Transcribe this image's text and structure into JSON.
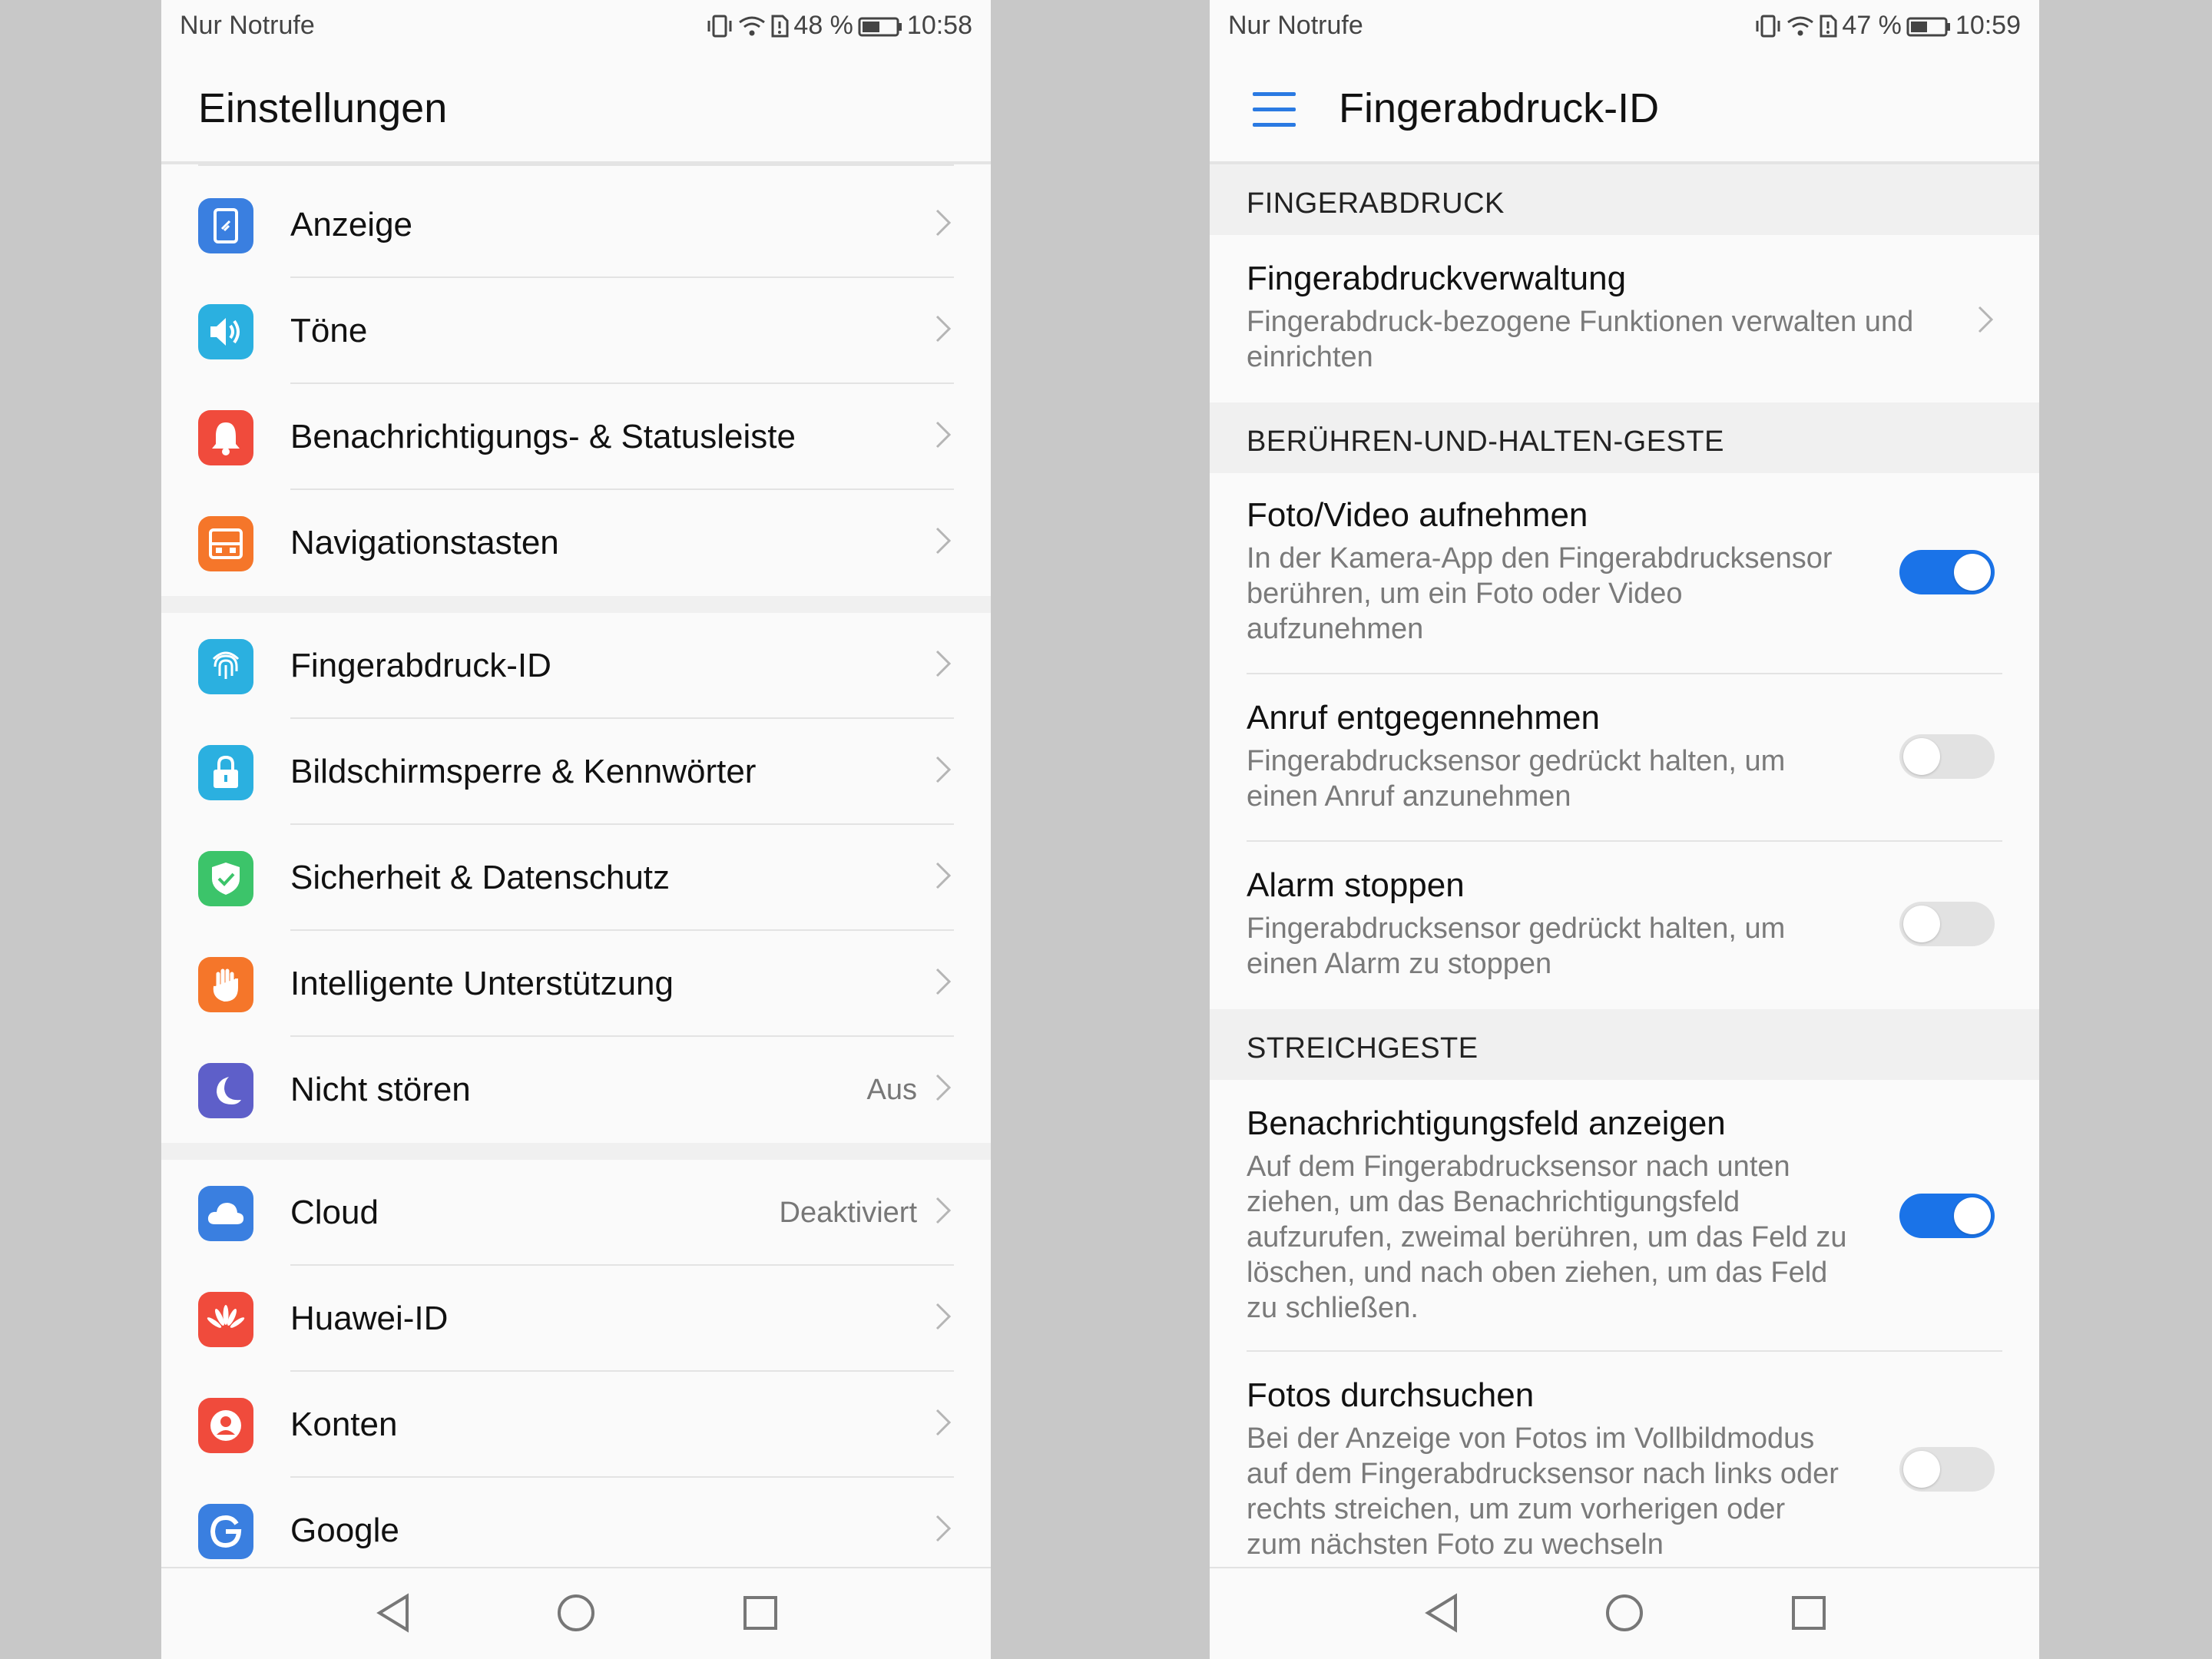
{
  "left": {
    "status": {
      "carrier": "Nur Notrufe",
      "battery": "48 %",
      "time": "10:58"
    },
    "title": "Einstellungen",
    "groups": [
      [
        {
          "label": "Anzeige",
          "icon": "display-icon",
          "color": "#3a7fe0"
        },
        {
          "label": "Töne",
          "icon": "speaker-icon",
          "color": "#2bb0e0"
        },
        {
          "label": "Benachrichtigungs- & Statusleiste",
          "icon": "bell-icon",
          "color": "#f04b3c"
        },
        {
          "label": "Navigationstasten",
          "icon": "navigation-keys-icon",
          "color": "#f5762a"
        }
      ],
      [
        {
          "label": "Fingerabdruck-ID",
          "icon": "fingerprint-icon",
          "color": "#2bb0e0"
        },
        {
          "label": "Bildschirmsperre & Kennwörter",
          "icon": "lock-icon",
          "color": "#2bb0e0"
        },
        {
          "label": "Sicherheit & Datenschutz",
          "icon": "shield-icon",
          "color": "#3cc46a"
        },
        {
          "label": "Intelligente Unterstützung",
          "icon": "hand-icon",
          "color": "#f5762a"
        },
        {
          "label": "Nicht stören",
          "icon": "moon-icon",
          "color": "#5e5fc9",
          "value": "Aus"
        }
      ],
      [
        {
          "label": "Cloud",
          "icon": "cloud-icon",
          "color": "#3a7fe0",
          "value": "Deaktiviert"
        },
        {
          "label": "Huawei-ID",
          "icon": "huawei-icon",
          "color": "#f04b3c"
        },
        {
          "label": "Konten",
          "icon": "account-icon",
          "color": "#f04b3c"
        },
        {
          "label": "Google",
          "icon": "google-icon",
          "color": "#3a7fe0"
        }
      ]
    ]
  },
  "right": {
    "status": {
      "carrier": "Nur Notrufe",
      "battery": "47 %",
      "time": "10:59"
    },
    "title": "Fingerabdruck-ID",
    "sections": [
      {
        "header": "FINGERABDRUCK"
      },
      {
        "header": "BERÜHREN-UND-HALTEN-GESTE"
      },
      {
        "header": "STREICHGESTE"
      }
    ],
    "items": {
      "verwaltung": {
        "title": "Fingerabdruckverwaltung",
        "desc1": "Fingerabdruck-bezogene Funktionen verwalten und",
        "desc2": "einrichten"
      },
      "foto": {
        "title": "Foto/Video aufnehmen",
        "desc1": "In der Kamera-App den Fingerabdrucksensor",
        "desc2": "berühren, um ein Foto oder Video",
        "desc3": "aufzunehmen",
        "on": true
      },
      "anruf": {
        "title": "Anruf entgegennehmen",
        "desc1": "Fingerabdrucksensor gedrückt halten, um",
        "desc2": "einen Anruf anzunehmen",
        "on": false
      },
      "alarm": {
        "title": "Alarm stoppen",
        "desc1": "Fingerabdrucksensor gedrückt halten, um",
        "desc2": "einen Alarm zu stoppen",
        "on": false
      },
      "benach": {
        "title": "Benachrichtigungsfeld anzeigen",
        "desc1": "Auf dem Fingerabdrucksensor nach unten",
        "desc2": "ziehen, um das Benachrichtigungsfeld",
        "desc3": "aufzurufen, zweimal berühren, um das Feld zu",
        "desc4": "löschen, und nach oben ziehen, um das Feld",
        "desc5": "zu schließen.",
        "on": true
      },
      "fotos": {
        "title": "Fotos durchsuchen",
        "desc1": "Bei der Anzeige von Fotos im Vollbildmodus",
        "desc2": "auf dem Fingerabdrucksensor nach links oder",
        "desc3": "rechts streichen, um zum vorherigen oder",
        "desc4": "zum nächsten Foto zu wechseln",
        "on": false
      }
    }
  }
}
